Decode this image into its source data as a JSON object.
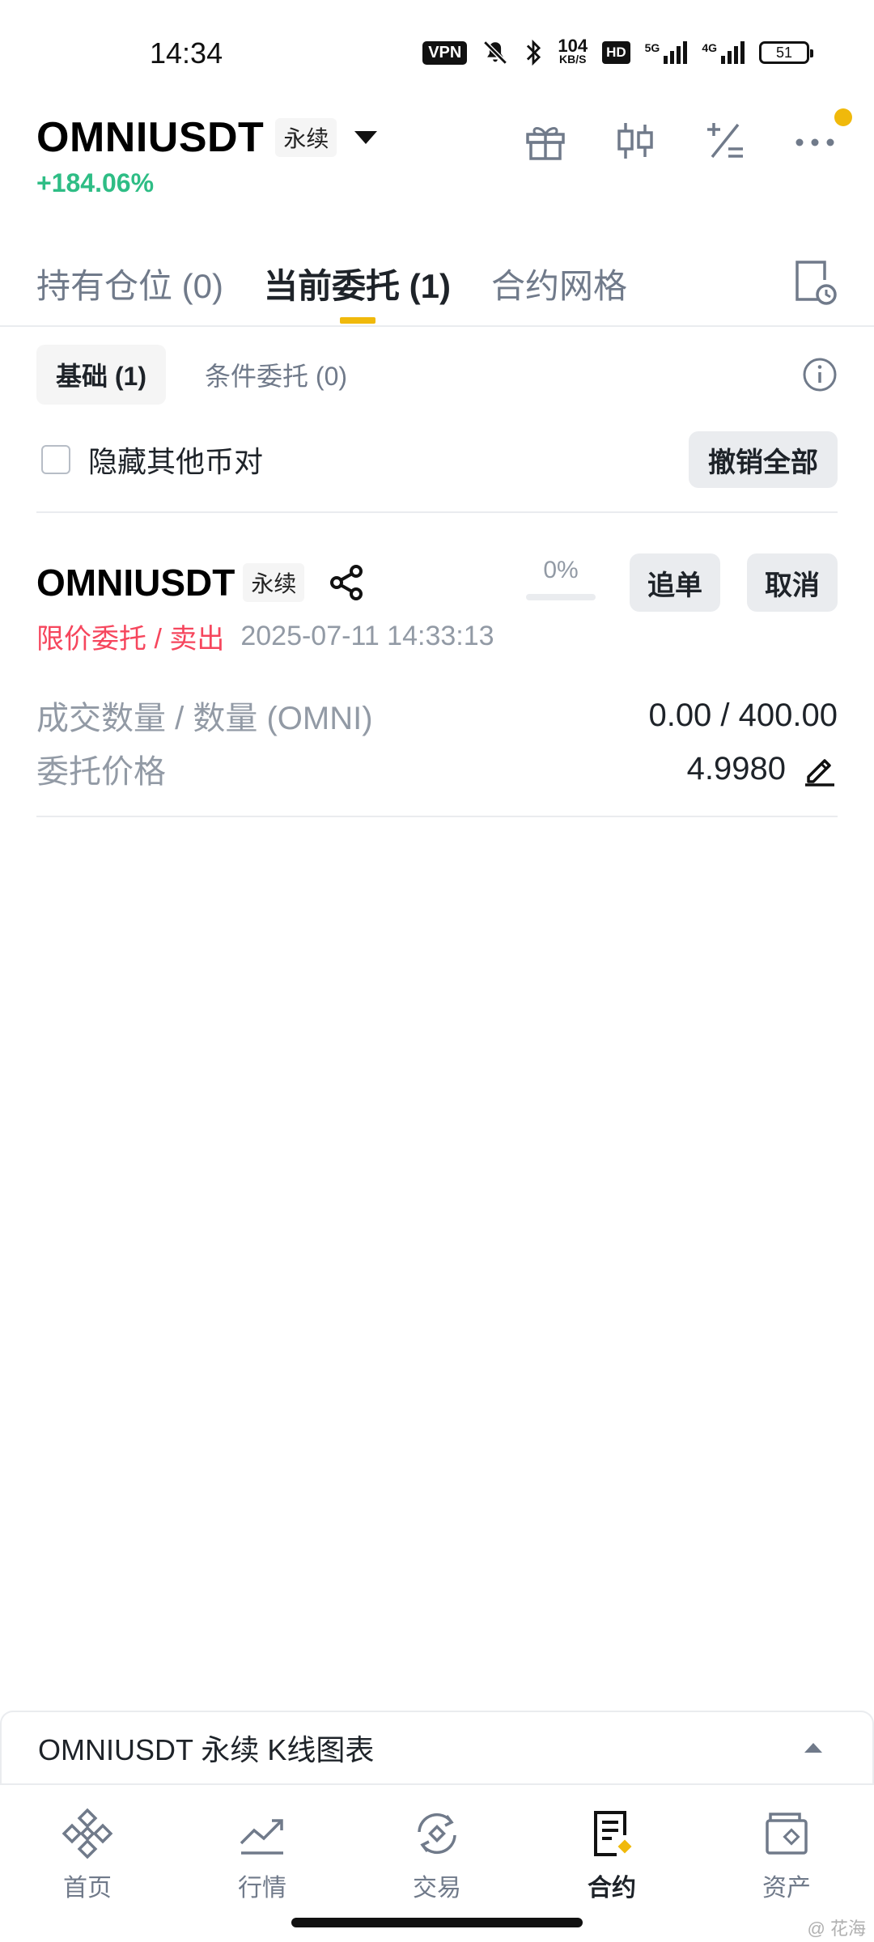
{
  "status_bar": {
    "time": "14:34",
    "vpn": "VPN",
    "speed_value": "104",
    "speed_unit": "KB/S",
    "hd": "HD",
    "net1": "5G",
    "net2": "4G",
    "battery": "51"
  },
  "header": {
    "symbol": "OMNIUSDT",
    "contract_type": "永续",
    "change": "+184.06%"
  },
  "tabs": [
    {
      "label": "持有仓位 (0)"
    },
    {
      "label": "当前委托 (1)"
    },
    {
      "label": "合约网格"
    }
  ],
  "sub_tabs": [
    {
      "label": "基础 (1)"
    },
    {
      "label": "条件委托 (0)"
    }
  ],
  "filter": {
    "hide_other_pairs": "隐藏其他币对",
    "cancel_all": "撤销全部"
  },
  "order": {
    "symbol": "OMNIUSDT",
    "contract_type": "永续",
    "fill_progress": "0%",
    "fill_fraction": 0,
    "side": "限价委托 / 卖出",
    "time": "2025-07-11 14:33:13",
    "chase_label": "追单",
    "cancel_label": "取消",
    "qty_label": "成交数量 / 数量 (OMNI)",
    "qty_value": "0.00 / 400.00",
    "price_label": "委托价格",
    "price_value": "4.9980"
  },
  "kline": {
    "title": "OMNIUSDT 永续 K线图表"
  },
  "nav": [
    {
      "label": "首页",
      "icon": "binance-logo-icon"
    },
    {
      "label": "行情",
      "icon": "market-chart-icon"
    },
    {
      "label": "交易",
      "icon": "trade-exchange-icon"
    },
    {
      "label": "合约",
      "icon": "futures-doc-icon"
    },
    {
      "label": "资产",
      "icon": "wallet-icon"
    }
  ],
  "watermark": "@ 花海",
  "colors": {
    "accent": "#f0b90b",
    "up": "#2ebd85",
    "down": "#f6465d"
  }
}
